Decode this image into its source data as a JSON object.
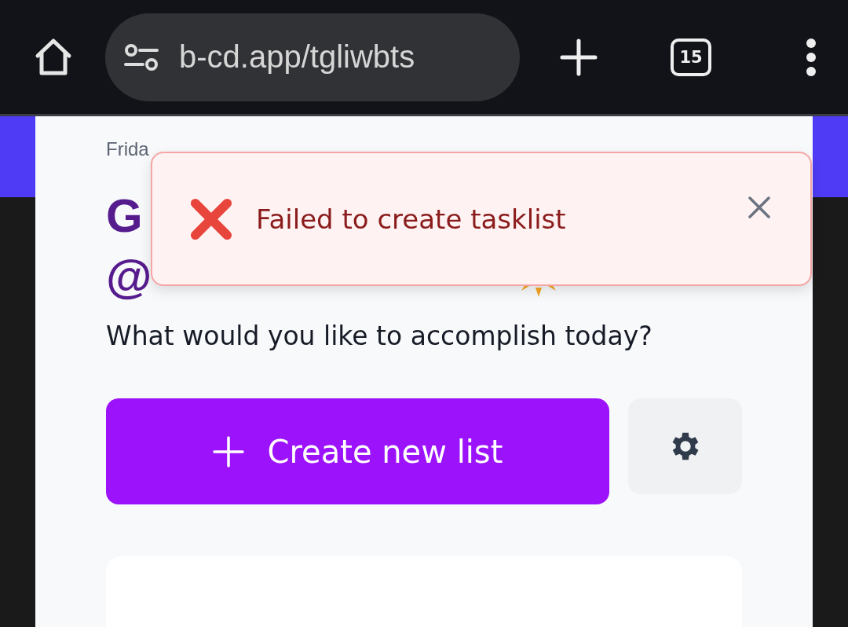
{
  "browser": {
    "url": "b-cd.app/tgliwbts",
    "tab_count": "15"
  },
  "page": {
    "date": "Frida",
    "greeting_line_1": "G",
    "greeting_line_2": "@",
    "subtitle": "What would you like to accomplish today?",
    "create_button": "Create new list"
  },
  "toast": {
    "kind": "error",
    "message": "Failed to create tasklist"
  }
}
